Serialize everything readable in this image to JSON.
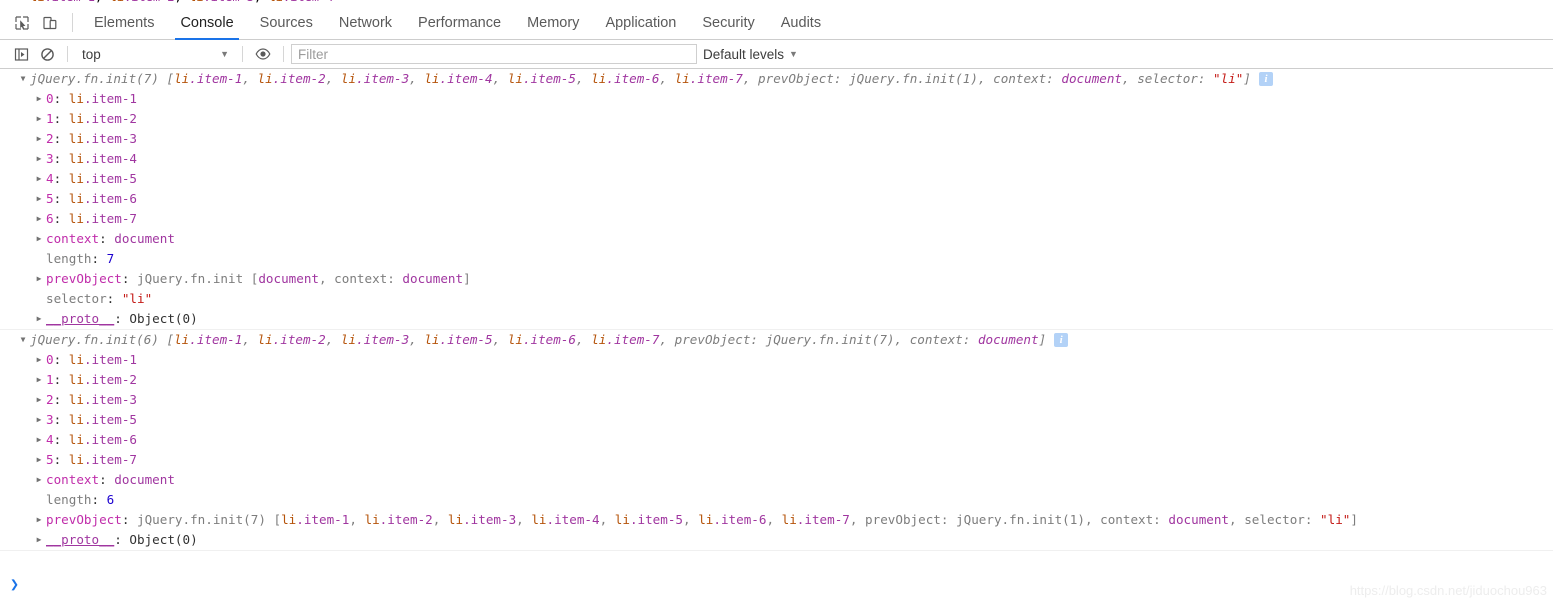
{
  "window": {
    "app": "Chrome DevTools"
  },
  "tabbar": {
    "inspect_icon": "inspect-element-icon",
    "device_icon": "device-toolbar-icon",
    "tabs": [
      {
        "label": "Elements",
        "active": false
      },
      {
        "label": "Console",
        "active": true
      },
      {
        "label": "Sources",
        "active": false
      },
      {
        "label": "Network",
        "active": false
      },
      {
        "label": "Performance",
        "active": false
      },
      {
        "label": "Memory",
        "active": false
      },
      {
        "label": "Application",
        "active": false
      },
      {
        "label": "Security",
        "active": false
      },
      {
        "label": "Audits",
        "active": false
      }
    ]
  },
  "console_toolbar": {
    "sidebar_toggle_icon": "console-sidebar-icon",
    "clear_console_icon": "clear-console-icon",
    "context": {
      "value": "top",
      "caret": "▼"
    },
    "eye_icon": "live-expression-eye-icon",
    "filter": {
      "value": "",
      "placeholder": "Filter"
    },
    "levels": {
      "label": "Default levels",
      "caret": "▼"
    }
  },
  "console": {
    "entries": [
      {
        "id": "entry-1",
        "expanded": true,
        "header": {
          "prefix": "jQuery.fn.init(7) ",
          "bracket_open": "[",
          "nodes": [
            "li.item-1",
            "li.item-2",
            "li.item-3",
            "li.item-4",
            "li.item-5",
            "li.item-6",
            "li.item-7"
          ],
          "tail_label_prev": "prevObject: ",
          "tail_prev_value": "jQuery.fn.init(1)",
          "tail_label_context": "context: ",
          "tail_context_value": "document",
          "tail_label_selector": "selector: ",
          "tail_selector_value": "\"li\"",
          "bracket_close": "]",
          "info_badge": "i"
        },
        "props": [
          {
            "kind": "node",
            "expandable": true,
            "key": "0",
            "value": "li.item-1"
          },
          {
            "kind": "node",
            "expandable": true,
            "key": "1",
            "value": "li.item-2"
          },
          {
            "kind": "node",
            "expandable": true,
            "key": "2",
            "value": "li.item-3"
          },
          {
            "kind": "node",
            "expandable": true,
            "key": "3",
            "value": "li.item-4"
          },
          {
            "kind": "node",
            "expandable": true,
            "key": "4",
            "value": "li.item-5"
          },
          {
            "kind": "node",
            "expandable": true,
            "key": "5",
            "value": "li.item-6"
          },
          {
            "kind": "node",
            "expandable": true,
            "key": "6",
            "value": "li.item-7"
          },
          {
            "kind": "context",
            "expandable": true,
            "key": "context",
            "value": "document"
          },
          {
            "kind": "number",
            "expandable": false,
            "key": "length",
            "value": "7"
          },
          {
            "kind": "prev1",
            "expandable": true,
            "key": "prevObject",
            "value": "jQuery.fn.init [document, context: document]"
          },
          {
            "kind": "string",
            "expandable": false,
            "key": "selector",
            "value": "\"li\""
          },
          {
            "kind": "proto",
            "expandable": true,
            "key": "__proto__",
            "value": "Object(0)"
          }
        ]
      },
      {
        "id": "entry-2",
        "expanded": true,
        "header": {
          "prefix": "jQuery.fn.init(6) ",
          "bracket_open": "[",
          "nodes": [
            "li.item-1",
            "li.item-2",
            "li.item-3",
            "li.item-5",
            "li.item-6",
            "li.item-7"
          ],
          "tail_label_prev": "prevObject: ",
          "tail_prev_value": "jQuery.fn.init(7)",
          "tail_label_context": "context: ",
          "tail_context_value": "document",
          "tail_label_selector": "",
          "tail_selector_value": "",
          "bracket_close": "]",
          "info_badge": "i"
        },
        "props": [
          {
            "kind": "node",
            "expandable": true,
            "key": "0",
            "value": "li.item-1"
          },
          {
            "kind": "node",
            "expandable": true,
            "key": "1",
            "value": "li.item-2"
          },
          {
            "kind": "node",
            "expandable": true,
            "key": "2",
            "value": "li.item-3"
          },
          {
            "kind": "node",
            "expandable": true,
            "key": "3",
            "value": "li.item-5"
          },
          {
            "kind": "node",
            "expandable": true,
            "key": "4",
            "value": "li.item-6"
          },
          {
            "kind": "node",
            "expandable": true,
            "key": "5",
            "value": "li.item-7"
          },
          {
            "kind": "context",
            "expandable": true,
            "key": "context",
            "value": "document"
          },
          {
            "kind": "number",
            "expandable": false,
            "key": "length",
            "value": "6"
          },
          {
            "kind": "prev2",
            "expandable": true,
            "key": "prevObject",
            "value": "jQuery.fn.init(7)"
          },
          {
            "kind": "proto",
            "expandable": true,
            "key": "__proto__",
            "value": "Object(0)"
          }
        ]
      }
    ],
    "prev2_detail": {
      "prefix": "jQuery.fn.init(7) ",
      "bracket_open": "[",
      "nodes": [
        "li.item-1",
        "li.item-2",
        "li.item-3",
        "li.item-4",
        "li.item-5",
        "li.item-6",
        "li.item-7"
      ],
      "tail_label_prev": "prevObject: ",
      "tail_prev_value": "jQuery.fn.init(1)",
      "tail_label_context": "context: ",
      "tail_context_value": "document",
      "tail_label_selector": "selector: ",
      "tail_selector_value": "\"li\"",
      "bracket_close": "]"
    }
  },
  "prompt": {
    "caret": "❯",
    "value": "",
    "placeholder": ""
  },
  "watermark": {
    "text": "https://blog.csdn.net/jiduochou963"
  },
  "colors": {
    "accent": "#1a73e8",
    "node_purple": "#a036a0",
    "tag_brown": "#b5530a",
    "key_magenta": "#c02caa",
    "number_blue": "#1c00cf",
    "string_red": "#c41a16",
    "header_gray": "#7d7d7d",
    "info_badge": "#b3d2f7"
  }
}
